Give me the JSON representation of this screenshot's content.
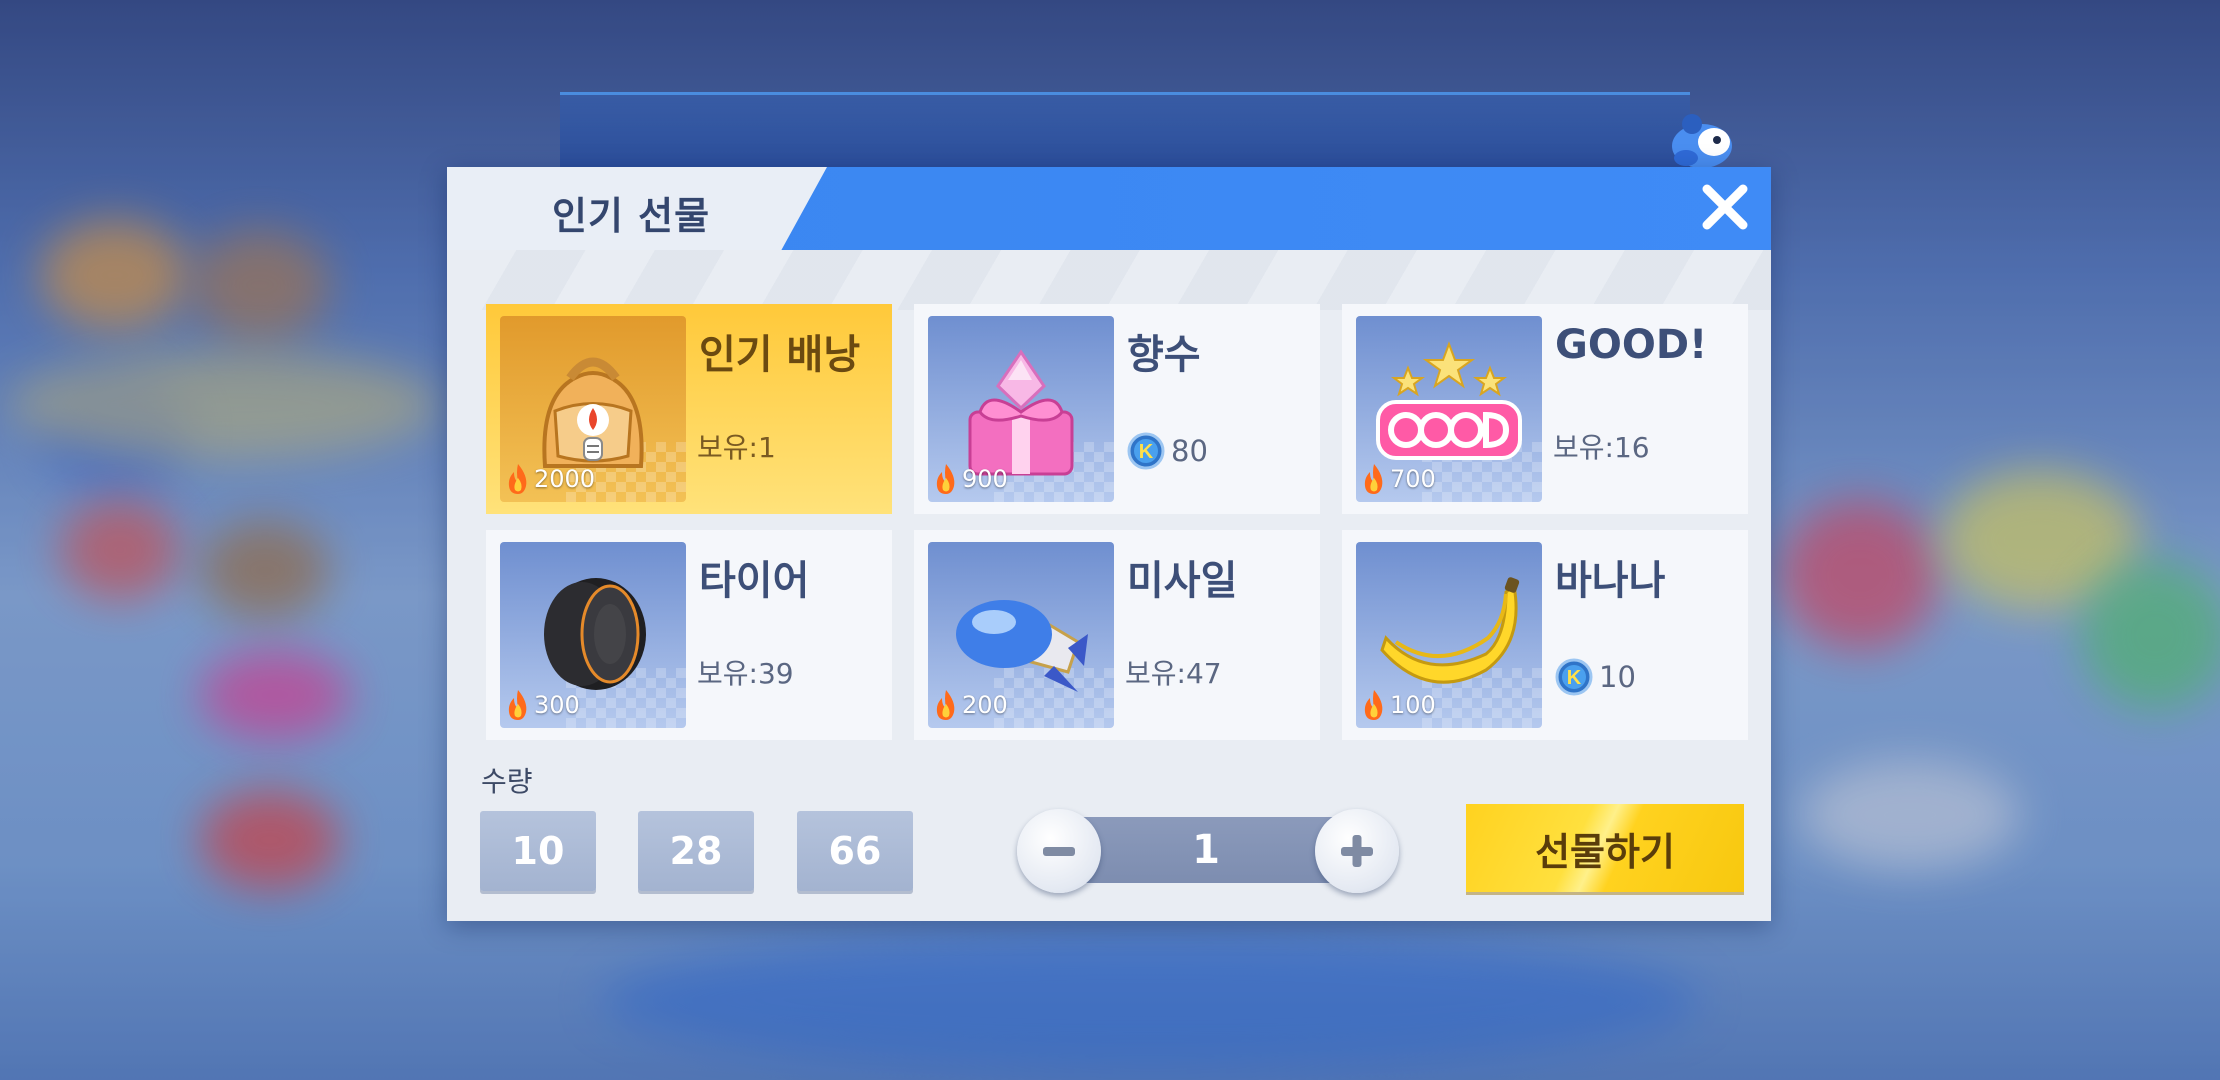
{
  "dialog": {
    "title": "인기 선물",
    "close_icon": "close-icon"
  },
  "items": [
    {
      "name": "인기 배낭",
      "cost": "2000",
      "owned": "보유:1",
      "selected": true,
      "art": "backpack"
    },
    {
      "name": "향수",
      "cost": "900",
      "price": "80",
      "art": "perfume"
    },
    {
      "name": "GOOD!",
      "cost": "700",
      "owned": "보유:16",
      "art": "good-sticker"
    },
    {
      "name": "타이어",
      "cost": "300",
      "owned": "보유:39",
      "art": "tire"
    },
    {
      "name": "미사일",
      "cost": "200",
      "owned": "보유:47",
      "art": "missile"
    },
    {
      "name": "바나나",
      "cost": "100",
      "price": "10",
      "art": "banana"
    }
  ],
  "quantity": {
    "label": "수량",
    "presets": [
      "10",
      "28",
      "66"
    ],
    "value": "1"
  },
  "gift_button": "선물하기",
  "colors": {
    "header": "#3f8bf6",
    "selected_card": "#ffc93a",
    "gift_button": "#ffd21f",
    "stepper": "#8b9abb"
  }
}
